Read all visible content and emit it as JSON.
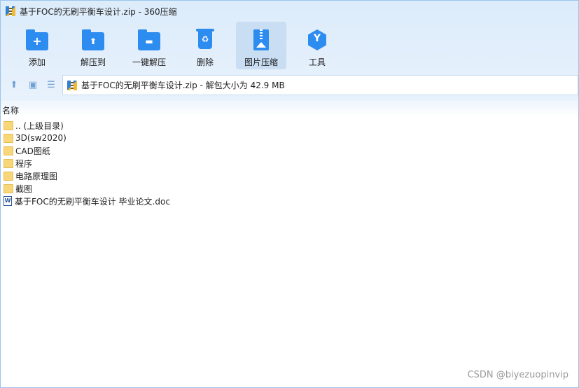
{
  "window": {
    "title": "基于FOC的无刷平衡车设计.zip - 360压缩"
  },
  "toolbar": {
    "items": [
      {
        "label": "添加",
        "icon": "add-icon",
        "glyph": "+"
      },
      {
        "label": "解压到",
        "icon": "extract-to-icon",
        "glyph": "⬆"
      },
      {
        "label": "一键解压",
        "icon": "one-click-extract-icon",
        "glyph": "▬"
      },
      {
        "label": "删除",
        "icon": "delete-icon",
        "glyph": "♻"
      },
      {
        "label": "图片压缩",
        "icon": "image-compress-icon",
        "glyph": ""
      },
      {
        "label": "工具",
        "icon": "tools-icon",
        "glyph": "Y"
      }
    ],
    "active_index": 4
  },
  "navbar": {
    "up_glyph": "⬆",
    "view_glyph": "▣",
    "list_glyph": "☰",
    "address": "基于FOC的无刷平衡车设计.zip - 解包大小为 42.9 MB"
  },
  "list": {
    "column_name": "名称",
    "rows": [
      {
        "name": ".. (上级目录)",
        "type": "folder"
      },
      {
        "name": "3D(sw2020)",
        "type": "folder"
      },
      {
        "name": "CAD图纸",
        "type": "folder"
      },
      {
        "name": "程序",
        "type": "folder"
      },
      {
        "name": "电路原理图",
        "type": "folder"
      },
      {
        "name": "截图",
        "type": "folder"
      },
      {
        "name": "基于FOC的无刷平衡车设计 毕业论文.doc",
        "type": "doc",
        "doc_glyph": "W"
      }
    ]
  },
  "watermark": "CSDN @biyezuopinvip",
  "colors": {
    "accent": "#2d8cf0",
    "folder": "#f7d77a",
    "active_tool": "#c9def3"
  }
}
